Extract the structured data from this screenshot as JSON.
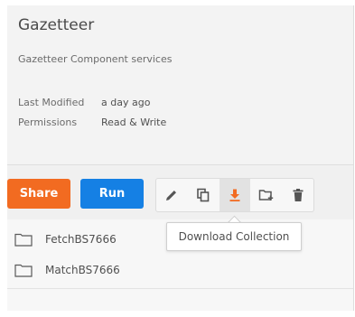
{
  "collection": {
    "title": "Gazetteer",
    "description": "Gazetteer Component services",
    "meta": [
      {
        "label": "Last Modified",
        "value": "a day ago"
      },
      {
        "label": "Permissions",
        "value": "Read & Write"
      }
    ]
  },
  "buttons": {
    "share_label": "Share",
    "run_label": "Run"
  },
  "toolbar": {
    "icons": [
      "edit-icon",
      "duplicate-icon",
      "download-icon",
      "add-folder-icon",
      "trash-icon"
    ],
    "active": "download-icon"
  },
  "tooltip": {
    "text": "Download Collection"
  },
  "folders": [
    {
      "name": "FetchBS7666"
    },
    {
      "name": "MatchBS7666"
    }
  ],
  "colors": {
    "share": "#f26b21",
    "run": "#1580e4",
    "download_icon": "#f26b21",
    "icon": "#555555"
  }
}
